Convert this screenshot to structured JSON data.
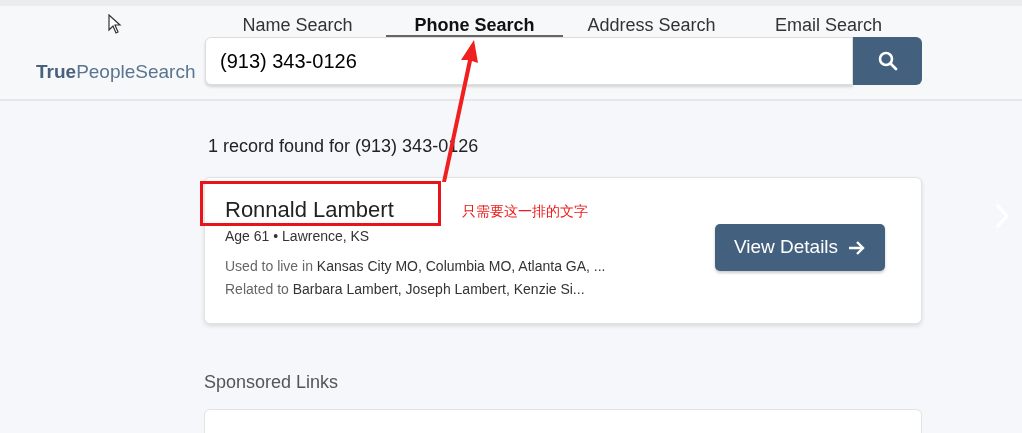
{
  "logo": "**True**PeopleSearch",
  "tabs": [
    {
      "label": "Name Search",
      "selected": false
    },
    {
      "label": "Phone Search",
      "selected": true
    },
    {
      "label": "Address Search",
      "selected": false
    },
    {
      "label": "Email Search",
      "selected": false
    }
  ],
  "search": {
    "value": "(913) 343-0126"
  },
  "result_summary": "1 record found for (913) 343-0126",
  "results": [
    {
      "name": "Ronnald Lambert",
      "age_location": "Age 61 • Lawrence, KS",
      "details": [
        {
          "label": "Used to live in",
          "value": "Kansas City MO, Columbia MO, Atlanta GA, ..."
        },
        {
          "label": "Related to",
          "value": "Barbara Lambert, Joseph Lambert, Kenzie Si..."
        }
      ],
      "button": "View Details"
    }
  ],
  "sponsored": {
    "title": "Sponsored Links"
  },
  "annotation": {
    "note": "只需要这一排的文字"
  }
}
